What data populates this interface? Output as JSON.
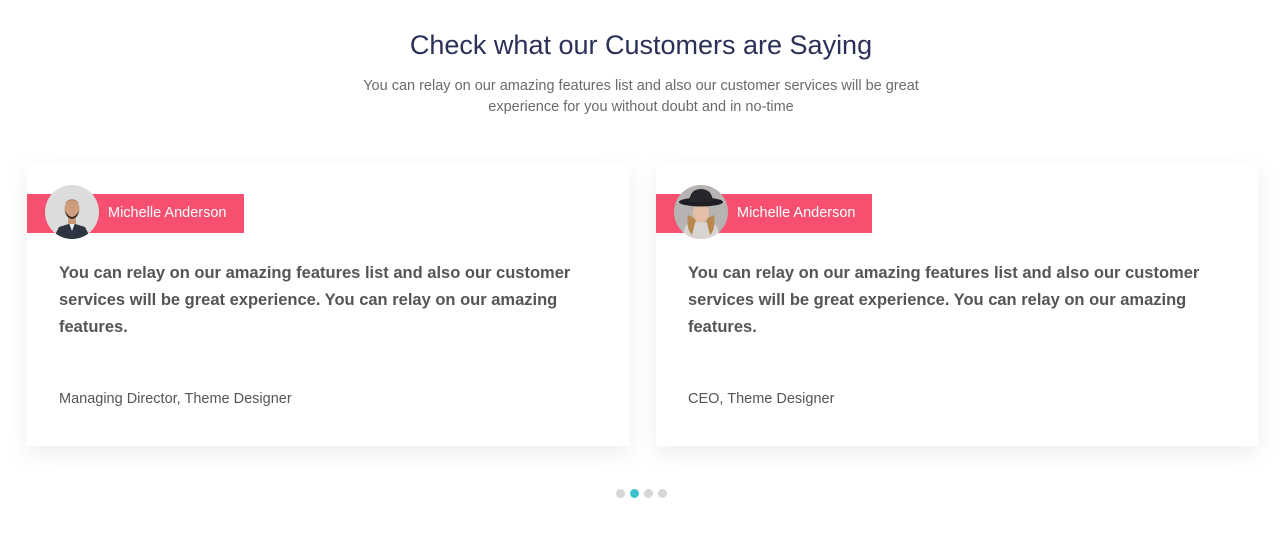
{
  "section": {
    "title": "Check what our Customers are Saying",
    "subtitle": "You can relay on our amazing features list and also our customer services will be great experience for you without doubt and in no-time"
  },
  "testimonials": [
    {
      "name": "Michelle Anderson",
      "quote": "You can relay on our amazing features list and also our customer services will be great experience. You can relay on our amazing features.",
      "role": "Managing Director, Theme Designer",
      "avatar_icon": "man-in-suit-avatar"
    },
    {
      "name": "Michelle Anderson",
      "quote": "You can relay on our amazing features list and also our customer services will be great experience. You can relay on our amazing features.",
      "role": "CEO, Theme Designer",
      "avatar_icon": "woman-in-hat-avatar"
    }
  ],
  "carousel": {
    "pages": 4,
    "active_page": 2
  },
  "colors": {
    "accent": "#f64f70",
    "active_dot": "#3cc2cf",
    "inactive_dot": "#d6d6d6",
    "title": "#2a3057"
  }
}
